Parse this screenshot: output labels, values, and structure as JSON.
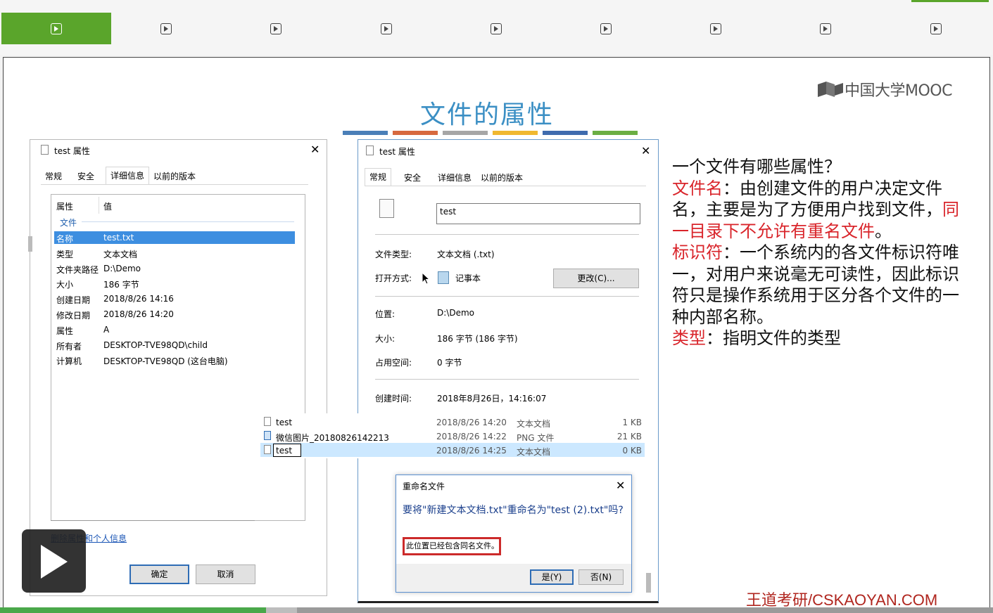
{
  "nav": {
    "tab_count": 9,
    "active_index": 0,
    "tab_icon": "play-square-icon",
    "accent_color": "#5aa52b"
  },
  "slide": {
    "title": "文件的属性",
    "title_color": "#3b8fc4",
    "stripe_colors": [
      "#4a7fb8",
      "#d7693f",
      "#a6a6a6",
      "#f0b830",
      "#3f6bae",
      "#6bae43"
    ],
    "logo_text": "中国大学MOOC",
    "footer_brand": "王道考研/CSKAOYAN.COM"
  },
  "left_dialog": {
    "title": "test 属性",
    "tabs": [
      "常规",
      "安全",
      "详细信息",
      "以前的版本"
    ],
    "selected_tab": "详细信息",
    "col_headers": [
      "属性",
      "值"
    ],
    "group": "文件",
    "rows": [
      {
        "key": "名称",
        "value": "test.txt"
      },
      {
        "key": "类型",
        "value": "文本文档"
      },
      {
        "key": "文件夹路径",
        "value": "D:\\Demo"
      },
      {
        "key": "大小",
        "value": "186 字节"
      },
      {
        "key": "创建日期",
        "value": "2018/8/26 14:16"
      },
      {
        "key": "修改日期",
        "value": "2018/8/26 14:20"
      },
      {
        "key": "属性",
        "value": "A"
      },
      {
        "key": "所有者",
        "value": "DESKTOP-TVE98QD\\child"
      },
      {
        "key": "计算机",
        "value": "DESKTOP-TVE98QD (这台电脑)"
      }
    ],
    "remove_link": "删除属性和个人信息",
    "ok": "确定",
    "cancel": "取消"
  },
  "right_dialog": {
    "title": "test 属性",
    "tabs": [
      "常规",
      "安全",
      "详细信息",
      "以前的版本"
    ],
    "selected_tab": "常规",
    "filename": "test",
    "type_label": "文件类型:",
    "type_value": "文本文档 (.txt)",
    "open_label": "打开方式:",
    "open_value": "记事本",
    "change_btn": "更改(C)...",
    "loc_label": "位置:",
    "loc_value": "D:\\Demo",
    "size_label": "大小:",
    "size_value": "186 字节 (186 字节)",
    "disk_label": "占用空间:",
    "disk_value": "0 字节",
    "created_label": "创建时间:",
    "created_value": "2018年8月26日，14:16:07"
  },
  "explorer": {
    "rows": [
      {
        "name": "test",
        "date": "2018/8/26 14:20",
        "type": "文本文档",
        "size": "1 KB"
      },
      {
        "name": "微信图片_20180826142213",
        "date": "2018/8/26 14:22",
        "type": "PNG 文件",
        "size": "21 KB"
      },
      {
        "name": "test",
        "date": "2018/8/26 14:25",
        "type": "文本文档",
        "size": "0 KB"
      }
    ]
  },
  "rename_dialog": {
    "title": "重命名文件",
    "message": "要将\"新建文本文档.txt\"重命名为\"test (2).txt\"吗?",
    "warning": "此位置已经包含同名文件。",
    "yes": "是(Y)",
    "no": "否(N)"
  },
  "notes": {
    "line1": "一个文件有哪些属性？",
    "name_term": "文件名",
    "name_desc1": "：由创建文件的用户决定文件名，主要是为了方便用户找到文件，",
    "name_desc_red": "同一目录下不允许有重名文件",
    "name_desc_end": "。",
    "id_term": "标识符",
    "id_desc": "：一个系统内的各文件标识符唯一，对用户来说毫无可读性，因此标识符只是操作系统用于区分各个文件的一种内部名称。",
    "type_term": "类型",
    "type_desc": "：指明文件的类型"
  },
  "player": {
    "progress_fraction": 0.268
  }
}
